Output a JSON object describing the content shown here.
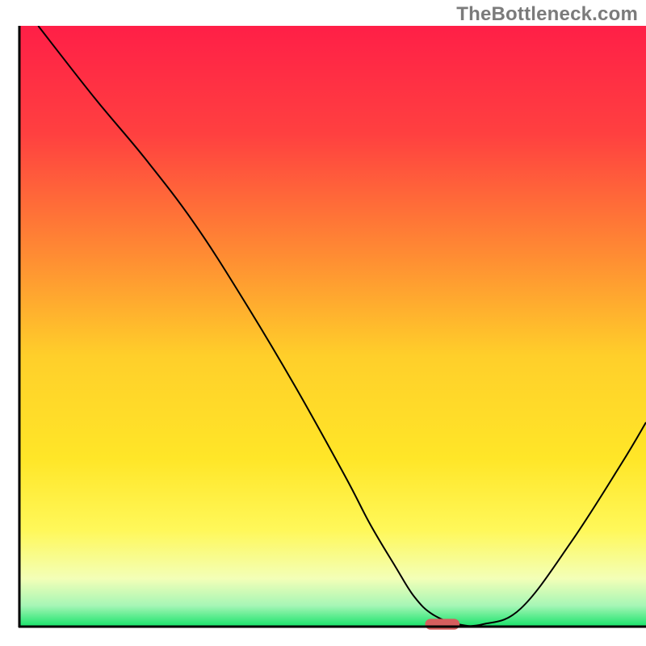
{
  "attribution": "TheBottleneck.com",
  "chart_data": {
    "type": "line",
    "title": "",
    "xlabel": "",
    "ylabel": "",
    "xlim": [
      0,
      100
    ],
    "ylim": [
      0,
      100
    ],
    "grid": false,
    "legend": false,
    "background": {
      "type": "vertical-gradient",
      "stops": [
        {
          "pos": 0.0,
          "color": "#ff1f47"
        },
        {
          "pos": 0.18,
          "color": "#ff4040"
        },
        {
          "pos": 0.38,
          "color": "#ff8b33"
        },
        {
          "pos": 0.55,
          "color": "#ffcf2a"
        },
        {
          "pos": 0.72,
          "color": "#ffe628"
        },
        {
          "pos": 0.84,
          "color": "#fff85a"
        },
        {
          "pos": 0.92,
          "color": "#f3ffb7"
        },
        {
          "pos": 0.965,
          "color": "#a6f6b6"
        },
        {
          "pos": 1.0,
          "color": "#17e36a"
        }
      ]
    },
    "axes": {
      "color": "#000000",
      "left_x": 3,
      "bottom_y": 97,
      "top_y": 4,
      "right_x": 100
    },
    "series": [
      {
        "name": "bottleneck-curve",
        "color": "#000000",
        "stroke_width": 2,
        "x": [
          3,
          12,
          20,
          28,
          36,
          44,
          52,
          56,
          60,
          63,
          66,
          70,
          74,
          80,
          88,
          96,
          100
        ],
        "y": [
          100,
          88,
          78,
          67,
          54,
          40,
          25,
          17,
          10,
          5,
          2,
          0.4,
          0.4,
          3,
          14,
          27,
          34
        ]
      }
    ],
    "marker": {
      "name": "optimal-point",
      "shape": "rounded-rect",
      "color": "#d55e5e",
      "x_center": 67.5,
      "y_center": 0.4,
      "width": 5.5,
      "height": 1.8
    }
  }
}
